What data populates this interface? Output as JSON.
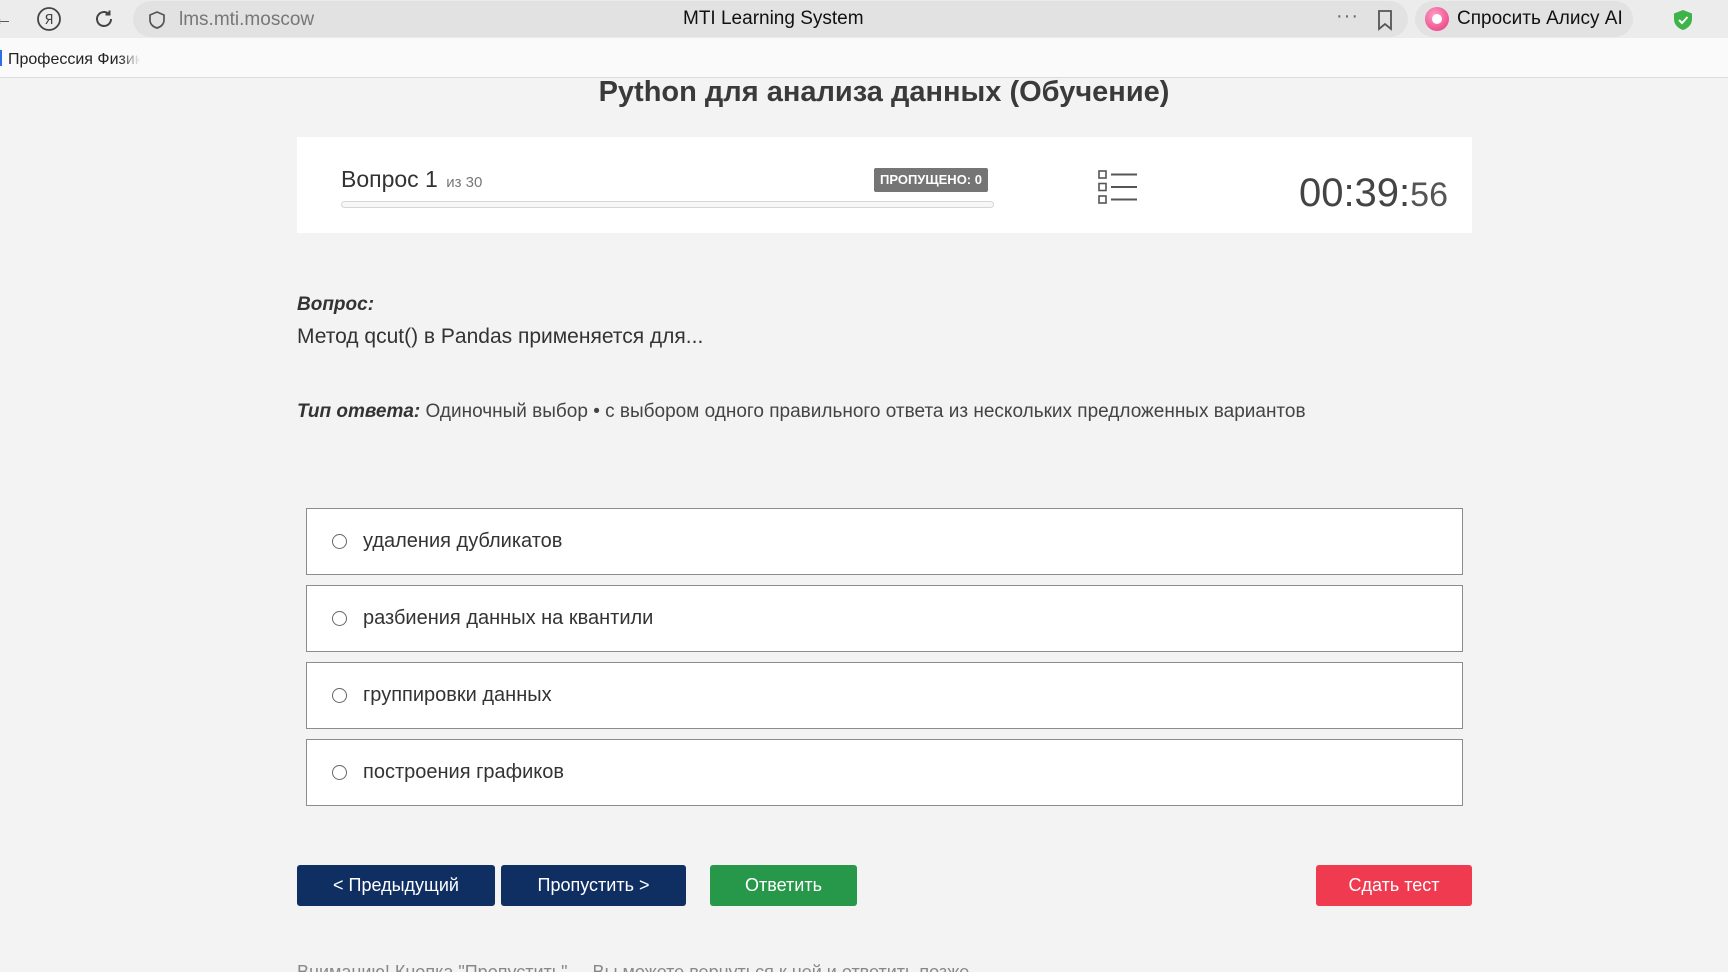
{
  "browser": {
    "url": "lms.mti.moscow",
    "page_title": "MTI Learning System",
    "more_glyph": "···",
    "alice_label": "Спросить Алису AI",
    "bookmark_label": "Профессия Физик",
    "back_glyph": "←",
    "yandex_glyph": "Я",
    "reload_glyph": "↻"
  },
  "course": {
    "title": "Python для анализа данных (Обучение)"
  },
  "question_header": {
    "question_label": "Вопрос 1",
    "of_total": "из 30",
    "skipped_badge": "ПРОПУЩЕНО: 0",
    "progress_fraction": 0.0,
    "timer_hm": "00:39:",
    "timer_sec": "56"
  },
  "question": {
    "label": "Вопрос:",
    "text": "Метод qcut() в Pandas применяется для...",
    "answer_type_label": "Тип ответа:",
    "answer_type_text": " Одиночный выбор • с выбором одного правильного ответа из нескольких предложенных вариантов"
  },
  "options": [
    {
      "text": "удаления дубликатов"
    },
    {
      "text": "разбиения данных на квантили"
    },
    {
      "text": "группировки данных"
    },
    {
      "text": "построения графиков"
    }
  ],
  "buttons": {
    "prev": "< Предыдущий",
    "skip": "Пропустить >",
    "answer": "Ответить",
    "submit": "Сдать тест"
  },
  "footer_partial": "Вниманию! Кнопка \"Пропустить\" ... Вы можете вернуться к ней и ответить позже"
}
